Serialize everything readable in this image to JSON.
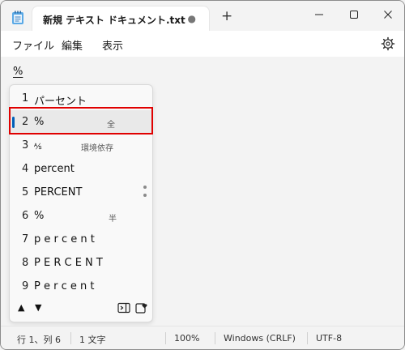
{
  "tab": {
    "title": "新規 テキスト ドキュメント.txt",
    "modified_dot": "●",
    "add_label": "+"
  },
  "menu": {
    "file": "ファイル",
    "edit": "編集",
    "view": "表示"
  },
  "editor": {
    "typed_text": "%"
  },
  "candidates": [
    {
      "num": "1",
      "text": "パーセント",
      "note": ""
    },
    {
      "num": "2",
      "text": "%",
      "note": "全",
      "selected": true
    },
    {
      "num": "3",
      "text": "",
      "note": "環境依存"
    },
    {
      "num": "4",
      "text": "percent",
      "note": ""
    },
    {
      "num": "5",
      "text": "PERCENT",
      "note": ""
    },
    {
      "num": "6",
      "text": "%",
      "note": "半"
    },
    {
      "num": "7",
      "text": "p e r c e n t",
      "note": ""
    },
    {
      "num": "8",
      "text": "P E R C E N T",
      "note": ""
    },
    {
      "num": "9",
      "text": "P e r c e n t",
      "note": ""
    }
  ],
  "footer": {
    "up": "▲",
    "down": "▼"
  },
  "status": {
    "position": "行 1、列 6",
    "chars": "1 文字",
    "zoom": "100%",
    "line_ending": "Windows (CRLF)",
    "encoding": "UTF-8"
  },
  "colors": {
    "selection_bar": "#005fb8",
    "highlight_box": "#e00000"
  }
}
